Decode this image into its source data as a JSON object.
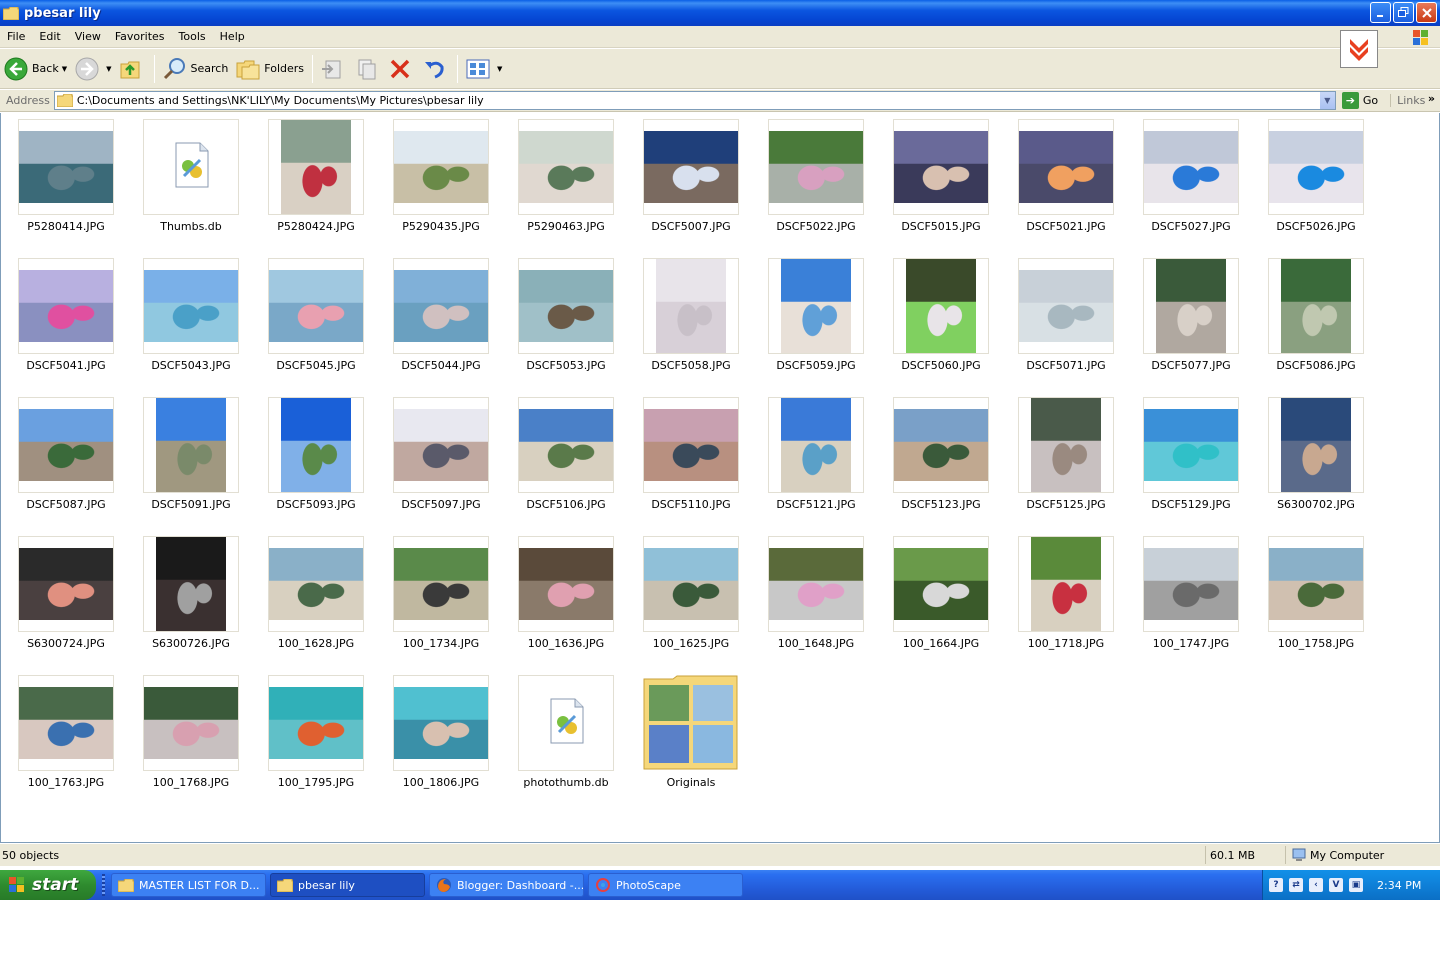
{
  "window": {
    "title": "pbesar lily"
  },
  "menu": [
    "File",
    "Edit",
    "View",
    "Favorites",
    "Tools",
    "Help"
  ],
  "toolbar": {
    "back_label": "Back",
    "search_label": "Search",
    "folders_label": "Folders"
  },
  "address": {
    "label": "Address",
    "path": "C:\\Documents and Settings\\NK'LILY\\My Documents\\My Pictures\\pbesar lily",
    "go_label": "Go",
    "links_label": "Links"
  },
  "files": [
    {
      "name": "P5280414.JPG",
      "kind": "photo",
      "orient": "land",
      "colors": [
        "#9fb4c4",
        "#5f7f8a",
        "#3b6a78"
      ]
    },
    {
      "name": "Thumbs.db",
      "kind": "db"
    },
    {
      "name": "P5280424.JPG",
      "kind": "photo",
      "orient": "port",
      "colors": [
        "#8aa090",
        "#c03040",
        "#d9d0c4"
      ]
    },
    {
      "name": "P5290435.JPG",
      "kind": "photo",
      "orient": "land",
      "colors": [
        "#dfe8ef",
        "#6a8a48",
        "#c8bfa6"
      ]
    },
    {
      "name": "P5290463.JPG",
      "kind": "photo",
      "orient": "land",
      "colors": [
        "#cfd8cf",
        "#5a7a5a",
        "#e0d8d0"
      ]
    },
    {
      "name": "DSCF5007.JPG",
      "kind": "photo",
      "orient": "land",
      "colors": [
        "#1f3f7a",
        "#d8e0ee",
        "#7a6a60"
      ]
    },
    {
      "name": "DSCF5022.JPG",
      "kind": "photo",
      "orient": "land",
      "colors": [
        "#4a7a3a",
        "#d8a0c0",
        "#a8b0a8"
      ]
    },
    {
      "name": "DSCF5015.JPG",
      "kind": "photo",
      "orient": "land",
      "colors": [
        "#6a6a9a",
        "#d8c0b0",
        "#3a3a5a"
      ]
    },
    {
      "name": "DSCF5021.JPG",
      "kind": "photo",
      "orient": "land",
      "colors": [
        "#5a5a8a",
        "#f0a060",
        "#4a4a6a"
      ]
    },
    {
      "name": "DSCF5027.JPG",
      "kind": "photo",
      "orient": "land",
      "colors": [
        "#c0c8d8",
        "#2a7ad8",
        "#e8e4ea"
      ]
    },
    {
      "name": "DSCF5026.JPG",
      "kind": "photo",
      "orient": "land",
      "colors": [
        "#c8d0e0",
        "#1a8ae0",
        "#e8e4ec"
      ]
    },
    {
      "name": "DSCF5041.JPG",
      "kind": "photo",
      "orient": "land",
      "colors": [
        "#b8b0e0",
        "#e050a0",
        "#8a90c0"
      ]
    },
    {
      "name": "DSCF5043.JPG",
      "kind": "photo",
      "orient": "land",
      "colors": [
        "#7ab0e8",
        "#4aa0c8",
        "#90c8e0"
      ]
    },
    {
      "name": "DSCF5045.JPG",
      "kind": "photo",
      "orient": "land",
      "colors": [
        "#a0c8e0",
        "#e8a0b0",
        "#7aa8c8"
      ]
    },
    {
      "name": "DSCF5044.JPG",
      "kind": "photo",
      "orient": "land",
      "colors": [
        "#80b0d8",
        "#d0c0c0",
        "#6aa0c0"
      ]
    },
    {
      "name": "DSCF5053.JPG",
      "kind": "photo",
      "orient": "land",
      "colors": [
        "#8ab0b8",
        "#6a5a48",
        "#a0c0c8"
      ]
    },
    {
      "name": "DSCF5058.JPG",
      "kind": "photo",
      "orient": "port",
      "colors": [
        "#e8e4ea",
        "#c8c0c8",
        "#d8d0d8"
      ]
    },
    {
      "name": "DSCF5059.JPG",
      "kind": "photo",
      "orient": "port",
      "colors": [
        "#3a80d8",
        "#60a0d8",
        "#e8e0d8"
      ]
    },
    {
      "name": "DSCF5060.JPG",
      "kind": "photo",
      "orient": "port",
      "colors": [
        "#3a4a2a",
        "#e8e4e8",
        "#80d060"
      ]
    },
    {
      "name": "DSCF5071.JPG",
      "kind": "photo",
      "orient": "land",
      "colors": [
        "#c8d0d8",
        "#a8b8c0",
        "#d8e0e4"
      ]
    },
    {
      "name": "DSCF5077.JPG",
      "kind": "photo",
      "orient": "port",
      "colors": [
        "#3a5a3a",
        "#d8d0c8",
        "#b0a8a0"
      ]
    },
    {
      "name": "DSCF5086.JPG",
      "kind": "photo",
      "orient": "port",
      "colors": [
        "#3a6a3a",
        "#c0c8b0",
        "#8aa080"
      ]
    },
    {
      "name": "DSCF5087.JPG",
      "kind": "photo",
      "orient": "land",
      "colors": [
        "#6aa0e0",
        "#3a6a3a",
        "#a09080"
      ]
    },
    {
      "name": "DSCF5091.JPG",
      "kind": "photo",
      "orient": "port",
      "colors": [
        "#3a80e0",
        "#7a8a6a",
        "#a09880"
      ]
    },
    {
      "name": "DSCF5093.JPG",
      "kind": "photo",
      "orient": "port",
      "colors": [
        "#1a60d8",
        "#5a8a4a",
        "#80b0e8"
      ]
    },
    {
      "name": "DSCF5097.JPG",
      "kind": "photo",
      "orient": "land",
      "colors": [
        "#e8e8f0",
        "#5a5a6a",
        "#c0a8a0"
      ]
    },
    {
      "name": "DSCF5106.JPG",
      "kind": "photo",
      "orient": "land",
      "colors": [
        "#4a80c8",
        "#5a7a4a",
        "#d8d0c0"
      ]
    },
    {
      "name": "DSCF5110.JPG",
      "kind": "photo",
      "orient": "land",
      "colors": [
        "#c8a0b0",
        "#3a4a5a",
        "#b89080"
      ]
    },
    {
      "name": "DSCF5121.JPG",
      "kind": "photo",
      "orient": "port",
      "colors": [
        "#3a7ad8",
        "#5aa0c8",
        "#d8d0c0"
      ]
    },
    {
      "name": "DSCF5123.JPG",
      "kind": "photo",
      "orient": "land",
      "colors": [
        "#7aa0c8",
        "#3a5a3a",
        "#c0a890"
      ]
    },
    {
      "name": "DSCF5125.JPG",
      "kind": "photo",
      "orient": "port",
      "colors": [
        "#4a5a4a",
        "#9a8a80",
        "#c8c0c0"
      ]
    },
    {
      "name": "DSCF5129.JPG",
      "kind": "photo",
      "orient": "land",
      "colors": [
        "#3a90d8",
        "#30c0c8",
        "#60c8d8"
      ]
    },
    {
      "name": "S6300702.JPG",
      "kind": "photo",
      "orient": "port",
      "colors": [
        "#2a4a7a",
        "#c8a890",
        "#5a6a8a"
      ]
    },
    {
      "name": "S6300724.JPG",
      "kind": "photo",
      "orient": "land",
      "colors": [
        "#2a2a2a",
        "#e09080",
        "#4a4040"
      ]
    },
    {
      "name": "S6300726.JPG",
      "kind": "photo",
      "orient": "port",
      "colors": [
        "#1a1a1a",
        "#a0a0a0",
        "#3a3030"
      ]
    },
    {
      "name": "100_1628.JPG",
      "kind": "photo",
      "orient": "land",
      "colors": [
        "#8ab0c8",
        "#4a6a4a",
        "#d8d0c0"
      ]
    },
    {
      "name": "100_1734.JPG",
      "kind": "photo",
      "orient": "land",
      "colors": [
        "#5a8a4a",
        "#3a3a3a",
        "#c0b8a0"
      ]
    },
    {
      "name": "100_1636.JPG",
      "kind": "photo",
      "orient": "land",
      "colors": [
        "#5a4a3a",
        "#e0a0b0",
        "#8a7a6a"
      ]
    },
    {
      "name": "100_1625.JPG",
      "kind": "photo",
      "orient": "land",
      "colors": [
        "#90c0d8",
        "#3a5a3a",
        "#c8c0b0"
      ]
    },
    {
      "name": "100_1648.JPG",
      "kind": "photo",
      "orient": "land",
      "colors": [
        "#5a6a3a",
        "#e0a0c8",
        "#c8c8c8"
      ]
    },
    {
      "name": "100_1664.JPG",
      "kind": "photo",
      "orient": "land",
      "colors": [
        "#6a9a4a",
        "#d8d8d8",
        "#3a5a2a"
      ]
    },
    {
      "name": "100_1718.JPG",
      "kind": "photo",
      "orient": "port",
      "colors": [
        "#5a8a3a",
        "#c83040",
        "#d8d0c0"
      ]
    },
    {
      "name": "100_1747.JPG",
      "kind": "photo",
      "orient": "land",
      "colors": [
        "#c8d0d8",
        "#6a6a6a",
        "#a0a0a0"
      ]
    },
    {
      "name": "100_1758.JPG",
      "kind": "photo",
      "orient": "land",
      "colors": [
        "#8ab0c8",
        "#4a6a3a",
        "#d0c0b0"
      ]
    },
    {
      "name": "100_1763.JPG",
      "kind": "photo",
      "orient": "land",
      "colors": [
        "#4a6a4a",
        "#3a70b0",
        "#d8c8c0"
      ]
    },
    {
      "name": "100_1768.JPG",
      "kind": "photo",
      "orient": "land",
      "colors": [
        "#3a5a3a",
        "#d8a0b0",
        "#c8c0c0"
      ]
    },
    {
      "name": "100_1795.JPG",
      "kind": "photo",
      "orient": "land",
      "colors": [
        "#30b0b8",
        "#e06030",
        "#60c0c8"
      ]
    },
    {
      "name": "100_1806.JPG",
      "kind": "photo",
      "orient": "land",
      "colors": [
        "#50c0d0",
        "#d8c0b0",
        "#3a90a8"
      ]
    },
    {
      "name": "photothumb.db",
      "kind": "db"
    },
    {
      "name": "Originals",
      "kind": "folder"
    }
  ],
  "status": {
    "objects": "50 objects",
    "size": "60.1 MB",
    "zone": "My Computer"
  },
  "taskbar": {
    "start_label": "start",
    "buttons": [
      {
        "label": "MASTER LIST FOR D...",
        "icon": "folder-icon",
        "active": false
      },
      {
        "label": "pbesar lily",
        "icon": "folder-icon",
        "active": true
      },
      {
        "label": "Blogger: Dashboard -...",
        "icon": "firefox-icon",
        "active": false
      },
      {
        "label": "PhotoScape",
        "icon": "photoscape-icon",
        "active": false
      }
    ],
    "clock": "2:34 PM"
  }
}
